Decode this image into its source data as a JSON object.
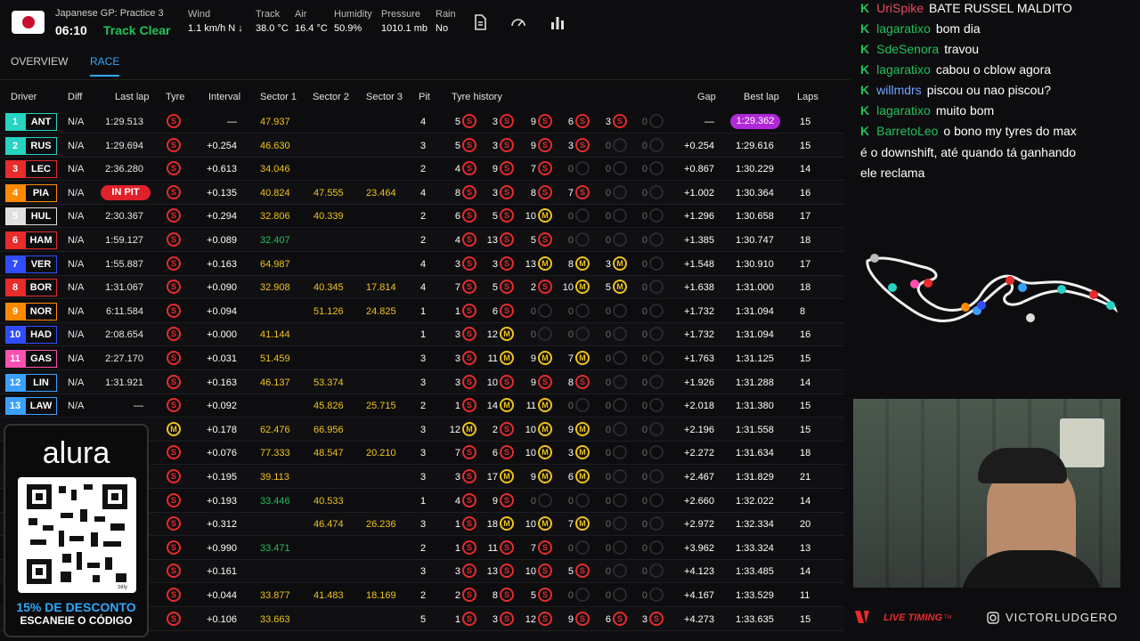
{
  "session": {
    "title": "Japanese GP: Practice 3",
    "clock": "06:10",
    "track_status": "Track Clear"
  },
  "weather": {
    "wind_label": "Wind",
    "wind": "1.1 km/h N ↓",
    "track_label": "Track",
    "track": "38.0 °C",
    "air_label": "Air",
    "air": "16.4 °C",
    "humidity_label": "Humidity",
    "humidity": "50.9%",
    "pressure_label": "Pressure",
    "pressure": "1010.1 mb",
    "rain_label": "Rain",
    "rain": "No"
  },
  "tabs": {
    "overview": "OVERVIEW",
    "race": "RACE"
  },
  "columns": {
    "driver": "Driver",
    "diff": "Diff",
    "lastlap": "Last lap",
    "tyre": "Tyre",
    "interval": "Interval",
    "s1": "Sector 1",
    "s2": "Sector 2",
    "s3": "Sector 3",
    "pit": "Pit",
    "history": "Tyre history",
    "gap": "Gap",
    "best": "Best lap",
    "laps": "Laps"
  },
  "colors": {
    "personal_best": "#21c15a",
    "overall_best": "#b028d8",
    "sector": "#f0c419",
    "soft": "#e82b2b",
    "medium": "#f0c419",
    "in_pit": "#e0202a"
  },
  "rows": [
    {
      "pos": "1",
      "code": "ANT",
      "color": "#27d3c2",
      "diff": "N/A",
      "last": "1:29.513",
      "tyre": "S",
      "interval": "—",
      "s1": "47.937",
      "s1c": "y",
      "s2": "",
      "s3": "",
      "pit": "4",
      "hist": [
        [
          "5",
          "S"
        ],
        [
          "3",
          "S"
        ],
        [
          "9",
          "S"
        ],
        [
          "6",
          "S"
        ],
        [
          "3",
          "S"
        ],
        [
          "0",
          "E"
        ]
      ],
      "gap": "—",
      "best": "1:29.362",
      "bestc": "p",
      "laps": "15"
    },
    {
      "pos": "2",
      "code": "RUS",
      "color": "#27d3c2",
      "diff": "N/A",
      "last": "1:29.694",
      "tyre": "S",
      "interval": "+0.254",
      "s1": "46.630",
      "s1c": "y",
      "s2": "",
      "s3": "",
      "pit": "3",
      "hist": [
        [
          "5",
          "S"
        ],
        [
          "3",
          "S"
        ],
        [
          "9",
          "S"
        ],
        [
          "3",
          "S"
        ],
        [
          "0",
          "E"
        ],
        [
          "0",
          "E"
        ]
      ],
      "gap": "+0.254",
      "best": "1:29.616",
      "laps": "15"
    },
    {
      "pos": "3",
      "code": "LEC",
      "color": "#e82b2b",
      "diff": "N/A",
      "last": "2:36.280",
      "tyre": "S",
      "interval": "+0.613",
      "s1": "34.046",
      "s1c": "y",
      "s2": "",
      "s3": "",
      "pit": "2",
      "hist": [
        [
          "4",
          "S"
        ],
        [
          "9",
          "S"
        ],
        [
          "7",
          "S"
        ],
        [
          "0",
          "E"
        ],
        [
          "0",
          "E"
        ],
        [
          "0",
          "E"
        ]
      ],
      "gap": "+0.867",
      "best": "1:30.229",
      "laps": "14"
    },
    {
      "pos": "4",
      "code": "PIA",
      "color": "#ff8a00",
      "diff": "N/A",
      "last": "IN PIT",
      "lastc": "pit",
      "tyre": "S",
      "interval": "+0.135",
      "s1": "40.824",
      "s1c": "y",
      "s2": "47.555",
      "s3": "23.464",
      "pit": "4",
      "hist": [
        [
          "8",
          "S"
        ],
        [
          "3",
          "S"
        ],
        [
          "8",
          "S"
        ],
        [
          "7",
          "S"
        ],
        [
          "0",
          "E"
        ],
        [
          "0",
          "E"
        ]
      ],
      "gap": "+1.002",
      "best": "1:30.364",
      "laps": "16"
    },
    {
      "pos": "5",
      "code": "HUL",
      "color": "#e0e0e0",
      "diff": "N/A",
      "last": "2:30.367",
      "tyre": "S",
      "interval": "+0.294",
      "s1": "32.806",
      "s1c": "y",
      "s2": "40.339",
      "s3": "",
      "pit": "2",
      "hist": [
        [
          "6",
          "S"
        ],
        [
          "5",
          "S"
        ],
        [
          "10",
          "M"
        ],
        [
          "0",
          "E"
        ],
        [
          "0",
          "E"
        ],
        [
          "0",
          "E"
        ]
      ],
      "gap": "+1.296",
      "best": "1:30.658",
      "laps": "17"
    },
    {
      "pos": "6",
      "code": "HAM",
      "color": "#e82b2b",
      "diff": "N/A",
      "last": "1:59.127",
      "tyre": "S",
      "interval": "+0.089",
      "s1": "32.407",
      "s1c": "g",
      "s2": "",
      "s3": "",
      "pit": "2",
      "hist": [
        [
          "4",
          "S"
        ],
        [
          "13",
          "S"
        ],
        [
          "5",
          "S"
        ],
        [
          "0",
          "E"
        ],
        [
          "0",
          "E"
        ],
        [
          "0",
          "E"
        ]
      ],
      "gap": "+1.385",
      "best": "1:30.747",
      "laps": "18"
    },
    {
      "pos": "7",
      "code": "VER",
      "color": "#2f4dff",
      "diff": "N/A",
      "last": "1:55.887",
      "tyre": "S",
      "interval": "+0.163",
      "s1": "64.987",
      "s1c": "y",
      "s2": "",
      "s3": "",
      "pit": "4",
      "hist": [
        [
          "3",
          "S"
        ],
        [
          "3",
          "S"
        ],
        [
          "13",
          "M"
        ],
        [
          "8",
          "M"
        ],
        [
          "3",
          "M"
        ],
        [
          "0",
          "E"
        ]
      ],
      "gap": "+1.548",
      "best": "1:30.910",
      "laps": "17"
    },
    {
      "pos": "8",
      "code": "BOR",
      "color": "#e82b2b",
      "diff": "N/A",
      "last": "1:31.067",
      "tyre": "S",
      "interval": "+0.090",
      "s1": "32.908",
      "s1c": "y",
      "s2": "40.345",
      "s3": "17.814",
      "pit": "4",
      "hist": [
        [
          "7",
          "S"
        ],
        [
          "5",
          "S"
        ],
        [
          "2",
          "S"
        ],
        [
          "10",
          "M"
        ],
        [
          "5",
          "M"
        ],
        [
          "0",
          "E"
        ]
      ],
      "gap": "+1.638",
      "best": "1:31.000",
      "laps": "18"
    },
    {
      "pos": "9",
      "code": "NOR",
      "color": "#ff8a00",
      "diff": "N/A",
      "last": "6:11.584",
      "tyre": "S",
      "interval": "+0.094",
      "s1": "",
      "s2": "51.126",
      "s3": "24.825",
      "pit": "1",
      "hist": [
        [
          "1",
          "S"
        ],
        [
          "6",
          "S"
        ],
        [
          "0",
          "E"
        ],
        [
          "0",
          "E"
        ],
        [
          "0",
          "E"
        ],
        [
          "0",
          "E"
        ]
      ],
      "gap": "+1.732",
      "best": "1:31.094",
      "laps": "8"
    },
    {
      "pos": "10",
      "code": "HAD",
      "color": "#2f4dff",
      "diff": "N/A",
      "last": "2:08.654",
      "tyre": "S",
      "interval": "+0.000",
      "s1": "41.144",
      "s1c": "y",
      "s2": "",
      "s3": "",
      "pit": "1",
      "hist": [
        [
          "3",
          "S"
        ],
        [
          "12",
          "M"
        ],
        [
          "0",
          "E"
        ],
        [
          "0",
          "E"
        ],
        [
          "0",
          "E"
        ],
        [
          "0",
          "E"
        ]
      ],
      "gap": "+1.732",
      "best": "1:31.094",
      "laps": "16"
    },
    {
      "pos": "11",
      "code": "GAS",
      "color": "#ff4fb0",
      "diff": "N/A",
      "last": "2:27.170",
      "tyre": "S",
      "interval": "+0.031",
      "s1": "51.459",
      "s1c": "y",
      "s2": "",
      "s3": "",
      "pit": "3",
      "hist": [
        [
          "3",
          "S"
        ],
        [
          "11",
          "M"
        ],
        [
          "9",
          "M"
        ],
        [
          "7",
          "M"
        ],
        [
          "0",
          "E"
        ],
        [
          "0",
          "E"
        ]
      ],
      "gap": "+1.763",
      "best": "1:31.125",
      "laps": "15"
    },
    {
      "pos": "12",
      "code": "LIN",
      "color": "#3aa0ff",
      "diff": "N/A",
      "last": "1:31.921",
      "tyre": "S",
      "interval": "+0.163",
      "s1": "46.137",
      "s1c": "y",
      "s2": "53.374",
      "s3": "",
      "pit": "3",
      "hist": [
        [
          "3",
          "S"
        ],
        [
          "10",
          "S"
        ],
        [
          "9",
          "S"
        ],
        [
          "8",
          "S"
        ],
        [
          "0",
          "E"
        ],
        [
          "0",
          "E"
        ]
      ],
      "gap": "+1.926",
      "best": "1:31.288",
      "laps": "14"
    },
    {
      "pos": "13",
      "code": "LAW",
      "color": "#3aa0ff",
      "diff": "N/A",
      "last": "—",
      "tyre": "S",
      "interval": "+0.092",
      "s1": "",
      "s2": "45.826",
      "s3": "25.715",
      "pit": "2",
      "hist": [
        [
          "1",
          "S"
        ],
        [
          "14",
          "M"
        ],
        [
          "11",
          "M"
        ],
        [
          "0",
          "E"
        ],
        [
          "0",
          "E"
        ],
        [
          "0",
          "E"
        ]
      ],
      "gap": "+2.018",
      "best": "1:31.380",
      "laps": "15"
    },
    {
      "tyre": "M",
      "interval": "+0.178",
      "s1": "62.476",
      "s1c": "y",
      "s2": "66.956",
      "s3": "",
      "pit": "3",
      "hist": [
        [
          "12",
          "M"
        ],
        [
          "2",
          "S"
        ],
        [
          "10",
          "M"
        ],
        [
          "9",
          "M"
        ],
        [
          "0",
          "E"
        ],
        [
          "0",
          "E"
        ]
      ],
      "gap": "+2.196",
      "best": "1:31.558",
      "laps": "15"
    },
    {
      "tyre": "S",
      "interval": "+0.076",
      "s1": "77.333",
      "s1c": "y",
      "s2": "48.547",
      "s3": "20.210",
      "pit": "3",
      "hist": [
        [
          "7",
          "S"
        ],
        [
          "6",
          "S"
        ],
        [
          "10",
          "M"
        ],
        [
          "3",
          "M"
        ],
        [
          "0",
          "E"
        ],
        [
          "0",
          "E"
        ]
      ],
      "gap": "+2.272",
      "best": "1:31.634",
      "laps": "18"
    },
    {
      "tyre": "S",
      "interval": "+0.195",
      "s1": "39.113",
      "s1c": "y",
      "s2": "",
      "s3": "",
      "pit": "3",
      "hist": [
        [
          "3",
          "S"
        ],
        [
          "17",
          "M"
        ],
        [
          "9",
          "M"
        ],
        [
          "6",
          "M"
        ],
        [
          "0",
          "E"
        ],
        [
          "0",
          "E"
        ]
      ],
      "gap": "+2.467",
      "best": "1:31.829",
      "laps": "21"
    },
    {
      "tyre": "S",
      "interval": "+0.193",
      "s1": "33.446",
      "s1c": "g",
      "s2": "40.533",
      "s3": "",
      "pit": "1",
      "hist": [
        [
          "4",
          "S"
        ],
        [
          "9",
          "S"
        ],
        [
          "0",
          "E"
        ],
        [
          "0",
          "E"
        ],
        [
          "0",
          "E"
        ],
        [
          "0",
          "E"
        ]
      ],
      "gap": "+2.660",
      "best": "1:32.022",
      "laps": "14"
    },
    {
      "tyre": "S",
      "interval": "+0.312",
      "s1": "",
      "s2": "46.474",
      "s3": "26.236",
      "pit": "3",
      "hist": [
        [
          "1",
          "S"
        ],
        [
          "18",
          "M"
        ],
        [
          "10",
          "M"
        ],
        [
          "7",
          "M"
        ],
        [
          "0",
          "E"
        ],
        [
          "0",
          "E"
        ]
      ],
      "gap": "+2.972",
      "best": "1:32.334",
      "laps": "20"
    },
    {
      "tyre": "S",
      "interval": "+0.990",
      "s1": "33.471",
      "s1c": "g",
      "s2": "",
      "s3": "",
      "pit": "2",
      "hist": [
        [
          "1",
          "S"
        ],
        [
          "11",
          "S"
        ],
        [
          "7",
          "S"
        ],
        [
          "0",
          "E"
        ],
        [
          "0",
          "E"
        ],
        [
          "0",
          "E"
        ]
      ],
      "gap": "+3.962",
      "best": "1:33.324",
      "laps": "13"
    },
    {
      "tyre": "S",
      "interval": "+0.161",
      "s1": "",
      "s2": "",
      "s3": "",
      "pit": "3",
      "hist": [
        [
          "3",
          "S"
        ],
        [
          "13",
          "S"
        ],
        [
          "10",
          "S"
        ],
        [
          "5",
          "S"
        ],
        [
          "0",
          "E"
        ],
        [
          "0",
          "E"
        ]
      ],
      "gap": "+4.123",
      "best": "1:33.485",
      "laps": "14"
    },
    {
      "tyre": "S",
      "interval": "+0.044",
      "s1": "33.877",
      "s1c": "y",
      "s2": "41.483",
      "s3": "18.169",
      "pit": "2",
      "hist": [
        [
          "2",
          "S"
        ],
        [
          "8",
          "S"
        ],
        [
          "5",
          "S"
        ],
        [
          "0",
          "E"
        ],
        [
          "0",
          "E"
        ],
        [
          "0",
          "E"
        ]
      ],
      "gap": "+4.167",
      "best": "1:33.529",
      "laps": "11"
    },
    {
      "tyre": "S",
      "interval": "+0.106",
      "s1": "33.663",
      "s1c": "y",
      "s2": "",
      "s3": "",
      "pit": "5",
      "hist": [
        [
          "1",
          "S"
        ],
        [
          "3",
          "S"
        ],
        [
          "12",
          "S"
        ],
        [
          "9",
          "S"
        ],
        [
          "6",
          "S"
        ],
        [
          "3",
          "S"
        ]
      ],
      "gap": "+4.273",
      "best": "1:33.635",
      "laps": "15"
    }
  ],
  "chat": [
    {
      "user": "UriSpike",
      "color": "#e84a5f",
      "msg": "BATE RUSSEL MALDITO"
    },
    {
      "user": "lagaratixo",
      "color": "#21c15a",
      "msg": "bom dia"
    },
    {
      "user": "SdeSenora",
      "color": "#21c15a",
      "msg": "travou"
    },
    {
      "user": "lagaratixo",
      "color": "#21c15a",
      "msg": "cabou o cblow agora"
    },
    {
      "user": "willmdrs",
      "color": "#6fa3ff",
      "msg": "piscou ou nao piscou?"
    },
    {
      "user": "lagaratixo",
      "color": "#21c15a",
      "msg": "muito bom"
    },
    {
      "user": "BarretoLeo",
      "color": "#21c15a",
      "msg": "o bono my tyres do max"
    }
  ],
  "chat_wrap": [
    "é o downshift, até quando tá ganhando",
    "ele reclama"
  ],
  "promo": {
    "brand": "alura",
    "line1": "15% DE DESCONTO",
    "line2": "ESCANEIE O CÓDIGO",
    "qr_small": "bitly"
  },
  "overlay": {
    "brand": "LIVE TIMING",
    "handle": "VICTORLUDGERO",
    "tm": "TM"
  }
}
